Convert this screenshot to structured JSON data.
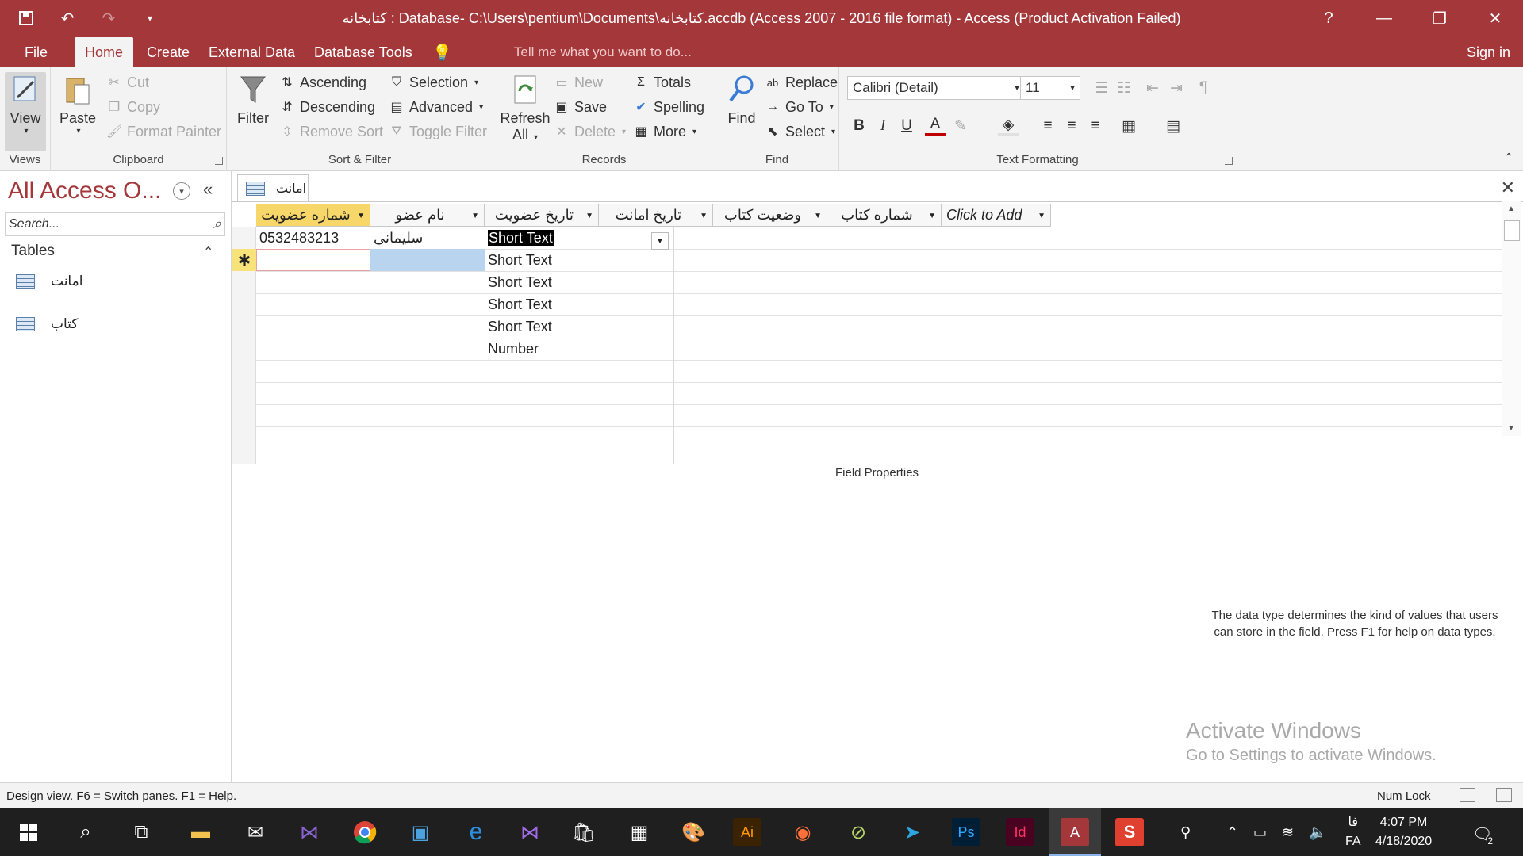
{
  "window": {
    "title": "کتابخانه : Database- C:\\Users\\pentium\\Documents\\کتابخانه.accdb (Access 2007 - 2016 file format) - Access (Product Activation Failed)",
    "help": "?",
    "minimize": "—",
    "restore": "❐",
    "close": "✕"
  },
  "menu": {
    "tabs": [
      "File",
      "Home",
      "Create",
      "External Data",
      "Database Tools"
    ],
    "active_tab": "Home",
    "tell_me": "Tell me what you want to do...",
    "sign_in": "Sign in"
  },
  "ribbon": {
    "views": {
      "label": "Views",
      "view": "View"
    },
    "clipboard": {
      "label": "Clipboard",
      "paste": "Paste",
      "cut": "Cut",
      "copy": "Copy",
      "format_painter": "Format Painter"
    },
    "sort_filter": {
      "label": "Sort & Filter",
      "filter": "Filter",
      "ascending": "Ascending",
      "descending": "Descending",
      "remove_sort": "Remove Sort",
      "selection": "Selection",
      "advanced": "Advanced",
      "toggle_filter": "Toggle Filter"
    },
    "records": {
      "label": "Records",
      "refresh": "Refresh",
      "refresh_all": "All",
      "new": "New",
      "save": "Save",
      "delete": "Delete",
      "totals": "Totals",
      "spelling": "Spelling",
      "more": "More"
    },
    "find": {
      "label": "Find",
      "find": "Find",
      "replace": "Replace",
      "goto": "Go To",
      "select": "Select"
    },
    "text_formatting": {
      "label": "Text Formatting",
      "font": "Calibri (Detail)",
      "size": "11"
    }
  },
  "nav": {
    "title": "All Access O...",
    "search_placeholder": "Search...",
    "section": "Tables",
    "items": [
      "امانت",
      "کتاب"
    ]
  },
  "document": {
    "tab": "امانت",
    "columns": [
      "شماره عضویت",
      "نام عضو",
      "تاریخ عضویت",
      "تاریخ امانت",
      "وضعیت کتاب",
      "شماره کتاب",
      "Click to Add"
    ],
    "row1": {
      "member_id": "0532483213",
      "member_name": "سلیمانی"
    },
    "data_types": [
      "Short Text",
      "Short Text",
      "Short Text",
      "Short Text",
      "Short Text",
      "Number"
    ],
    "new_row_marker": "✱",
    "field_properties_label": "Field Properties",
    "help_text": "The data type determines the kind of values that users can store in the field. Press F1 for help on data types."
  },
  "watermark": {
    "line1": "Activate Windows",
    "line2": "Go to Settings to activate Windows."
  },
  "status": {
    "left": "Design view.  F6 = Switch panes.  F1 = Help.",
    "num_lock": "Num Lock"
  },
  "taskbar": {
    "lang_top": "فا",
    "lang_bottom": "FA",
    "time": "4:07 PM",
    "date": "4/18/2020",
    "notifications": "2"
  },
  "colors": {
    "accent": "#a4373a",
    "selected_header": "#f8d76a",
    "taskbar": "#1f1f1f"
  }
}
